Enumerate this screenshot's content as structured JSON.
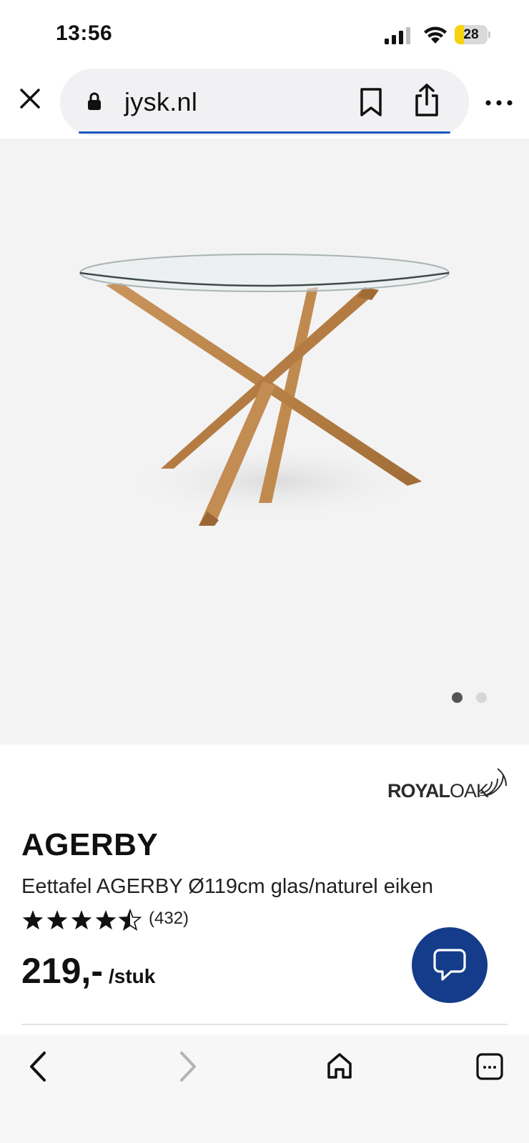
{
  "status_bar": {
    "time": "13:56",
    "battery_level": "28",
    "battery_fraction": 0.28,
    "battery_color": "#f7d20f"
  },
  "browser": {
    "url": "jysk.nl",
    "icons": [
      "close-icon",
      "lock-icon",
      "bookmark-icon",
      "share-icon",
      "more-icon"
    ],
    "progress_color": "#1a56c4"
  },
  "gallery": {
    "current_index": 1,
    "total_images": 2
  },
  "product": {
    "brand_bold": "ROYAL",
    "brand_thin": "OAK",
    "name": "AGERBY",
    "description": "Eettafel AGERBY Ø119cm glas/naturel eiken",
    "rating_value": 4.5,
    "rating_max": 5,
    "review_count": "(432)",
    "price": "219,-",
    "unit": "/stuk"
  },
  "chat": {
    "icon": "chat-bubble-icon",
    "color": "#143c8a"
  },
  "toolbar": {
    "icons": [
      "back-arrow-icon",
      "forward-arrow-icon",
      "home-icon",
      "tabs-icon"
    ]
  }
}
